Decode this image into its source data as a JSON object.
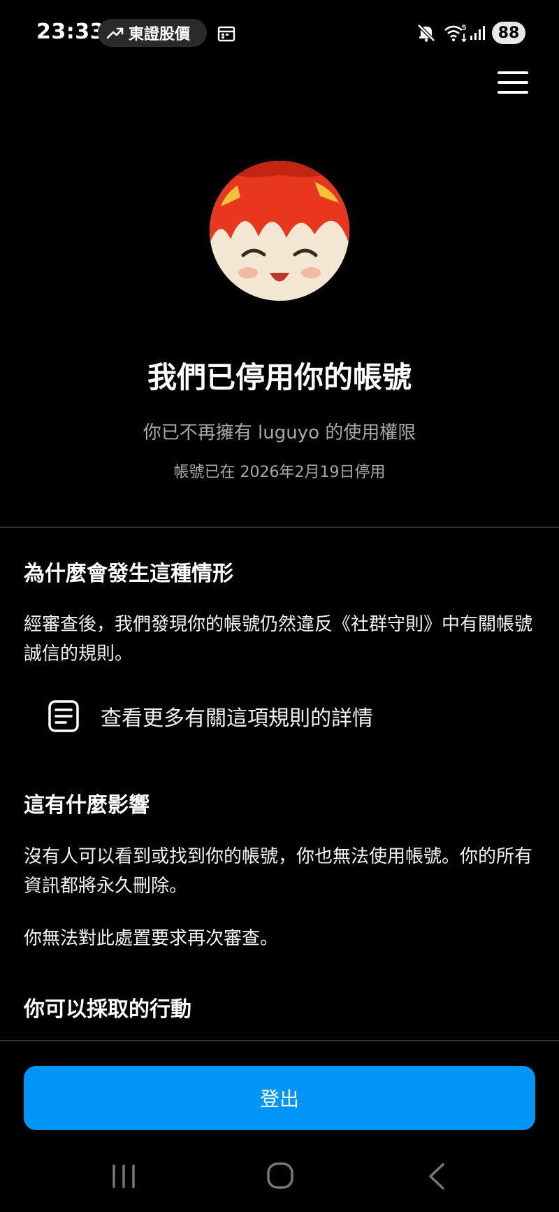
{
  "status_bar": {
    "time": "23:33",
    "pill_label": "東證股價",
    "battery": "88",
    "icons": [
      "trending-up-icon",
      "calendar-icon",
      "mute-icon",
      "wifi-icon",
      "signal-icon"
    ]
  },
  "header": {
    "menu_icon": "hamburger-menu-icon"
  },
  "account": {
    "headline": "我們已停用你的帳號",
    "access_notice": "你已不再擁有 luguyo 的使用權限",
    "disabled_date": "帳號已在 2026年2月19日停用"
  },
  "why": {
    "title": "為什麼會發生這種情形",
    "body": "經審查後，我們發現你的帳號仍然違反《社群守則》中有關帳號誠信的規則。",
    "link_label": "查看更多有關這項規則的詳情",
    "link_icon": "document-icon"
  },
  "impact": {
    "title": "這有什麼影響",
    "body": "沒有人可以看到或找到你的帳號，你也無法使用帳號。你的所有資訊都將永久刪除。",
    "review_note": "你無法對此處置要求再次審查。"
  },
  "actions": {
    "title": "你可以採取的行動"
  },
  "footer": {
    "logout_label": "登出"
  },
  "colors": {
    "background": "#000000",
    "primary_button": "#0095f6",
    "secondary_text": "#a8a8a8"
  }
}
